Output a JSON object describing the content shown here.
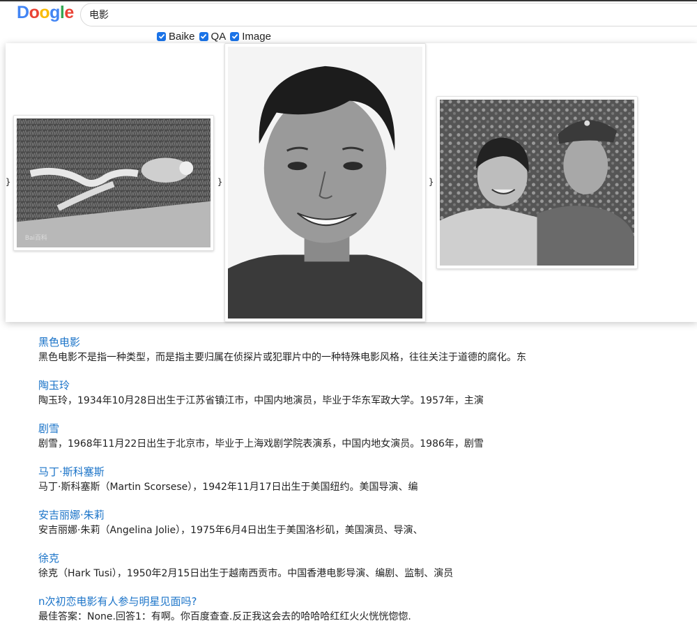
{
  "logo": {
    "letters": [
      "D",
      "o",
      "o",
      "g",
      "l",
      "e"
    ],
    "colors": [
      "#4285f4",
      "#ea4335",
      "#fbbc05",
      "#4285f4",
      "#34a853",
      "#ea4335"
    ]
  },
  "search": {
    "value": "电影"
  },
  "filters": [
    {
      "label": "Baike",
      "checked": true
    },
    {
      "label": "QA",
      "checked": true
    },
    {
      "label": "Image",
      "checked": true
    }
  ],
  "gallery": {
    "braces": [
      "}",
      "}",
      "}"
    ],
    "images": [
      {
        "alt": "black-and-white photo of a person lying on grass",
        "watermark": "Bai百科"
      },
      {
        "alt": "black-and-white portrait of a smiling young woman"
      },
      {
        "alt": "black-and-white photo of a young woman and a soldier in cap"
      }
    ]
  },
  "results": [
    {
      "title": "黑色电影",
      "snippet": "黑色电影不是指一种类型，而是指主要归属在侦探片或犯罪片中的一种特殊电影风格，往往关注于道德的腐化。东"
    },
    {
      "title": "陶玉玲",
      "snippet": "陶玉玲，1934年10月28日出生于江苏省镇江市，中国内地演员，毕业于华东军政大学。1957年，主演"
    },
    {
      "title": "剧雪",
      "snippet": "剧雪，1968年11月22日出生于北京市，毕业于上海戏剧学院表演系，中国内地女演员。1986年，剧雪"
    },
    {
      "title": "马丁·斯科塞斯",
      "snippet": "马丁·斯科塞斯（Martin Scorsese），1942年11月17日出生于美国纽约。美国导演、编"
    },
    {
      "title": "安吉丽娜·朱莉",
      "snippet": "安吉丽娜·朱莉（Angelina Jolie），1975年6月4日出生于美国洛杉矶，美国演员、导演、"
    },
    {
      "title": "徐克",
      "snippet": "徐克（Hark Tusi），1950年2月15日出生于越南西贡市。中国香港电影导演、编剧、监制、演员"
    },
    {
      "title": "n次初恋电影有人参与明星见面吗?",
      "snippet": "最佳答案：None.回答1：有啊。你百度查查.反正我这会去的哈哈哈红红火火恍恍惚惚."
    }
  ]
}
